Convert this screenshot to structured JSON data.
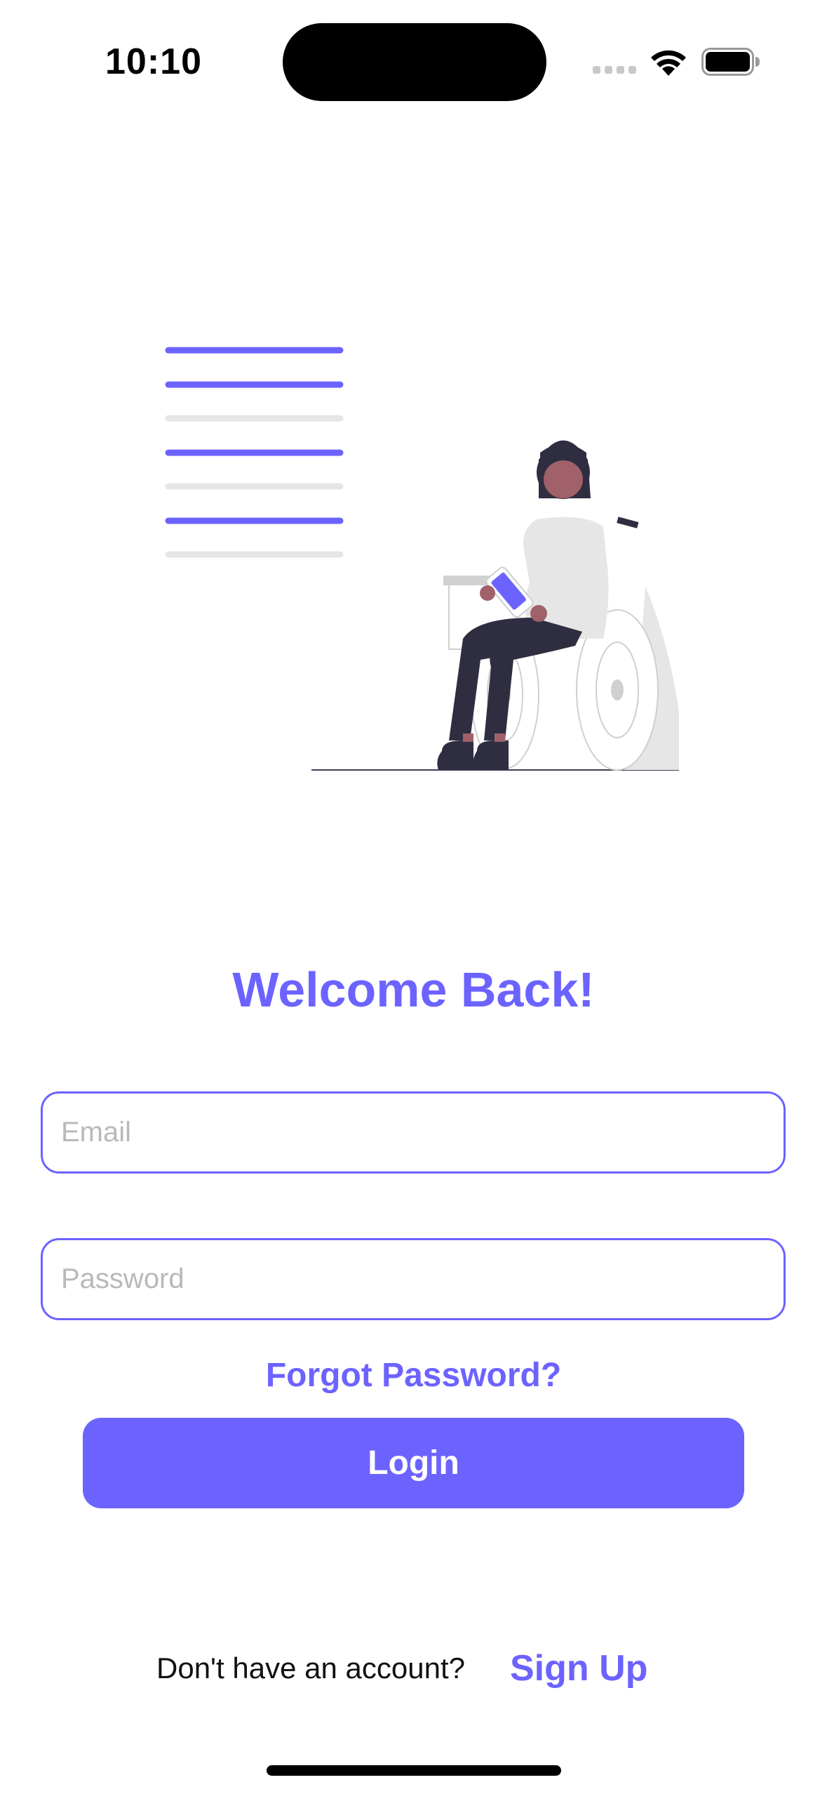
{
  "status_bar": {
    "time": "10:10"
  },
  "login": {
    "title": "Welcome Back!",
    "email_placeholder": "Email",
    "email_value": "",
    "password_placeholder": "Password",
    "password_value": "",
    "forgot_label": "Forgot Password?",
    "login_label": "Login",
    "signup_prompt": "Don't have an account?",
    "signup_label": "Sign Up"
  },
  "colors": {
    "accent": "#6C63FF",
    "illustration_dark": "#2f2e41",
    "illustration_light": "#e6e6e6",
    "skin": "#a0616a"
  },
  "illustration": {
    "subject": "person-in-wheelchair-with-phone-and-text-lines"
  }
}
